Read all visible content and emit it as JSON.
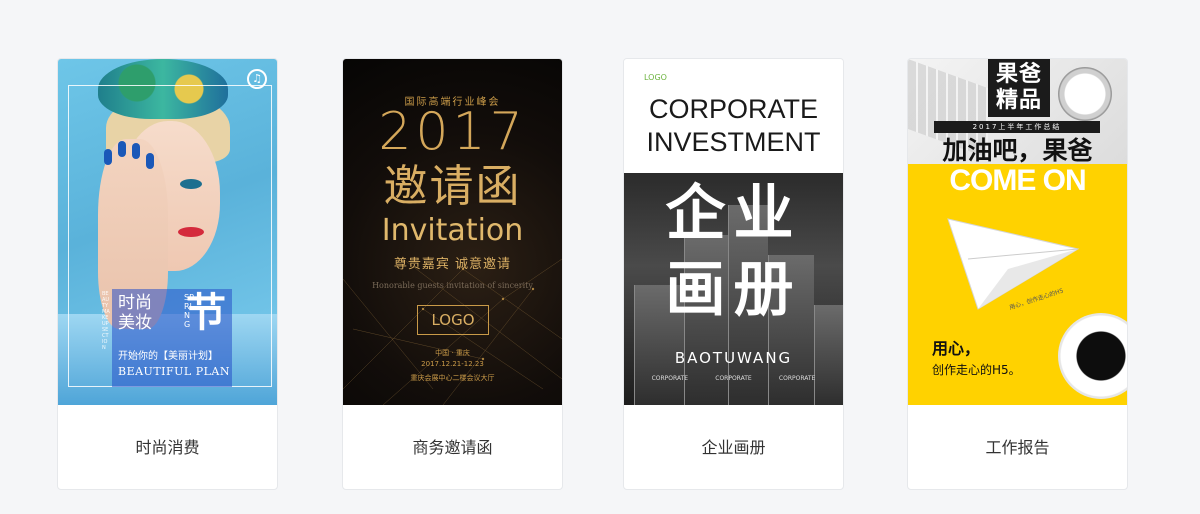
{
  "cards": [
    {
      "caption": "时尚消费",
      "poster": {
        "line1": "时尚",
        "line2": "美妆",
        "big_char": "节",
        "spring": "SPRING",
        "subtitle": "开始你的【美丽计划】",
        "slogan": "BEAUTIFUL PLAN",
        "side_text": "BEAUTY MAKE UP SECTION",
        "music_icon": "music-note-icon"
      }
    },
    {
      "caption": "商务邀请函",
      "poster": {
        "top_line": "国际高端行业峰会",
        "year": "2017",
        "title_cn": "邀请函",
        "title_en": "Invitation",
        "sub_cn": "尊贵嘉宾 诚意邀请",
        "sub_en": "Honorable guests  invitation of sincerity",
        "logo": "LOGO",
        "place": "中国 · 重庆",
        "date": "2017.12.21-12.23",
        "venue": "重庆会展中心二楼会议大厅"
      }
    },
    {
      "caption": "企业画册",
      "poster": {
        "logo": "LOGO",
        "head1": "CORPORATE",
        "head2": "INVESTMENT",
        "cn1": "企业",
        "cn2": "画册",
        "brand": "BAOTUWANG",
        "foot": [
          "CORPORATE",
          "CORPORATE",
          "CORPORATE"
        ]
      }
    },
    {
      "caption": "工作报告",
      "poster": {
        "logo": "果爸\n精品",
        "bar": "2017上半年工作总结",
        "title": "加油吧，果爸",
        "come_on": "COME ON",
        "slogan1": "用心，",
        "slogan2": "创作走心的H5。",
        "curve_text": "用心，创作走心的H5"
      }
    }
  ],
  "colors": {
    "background": "#f5f6f8",
    "card_border": "#e6e8eb",
    "caption_text": "#333333",
    "gold": "#d4a75a",
    "report_yellow": "#ffd200",
    "corporate_green": "#6cb33f"
  }
}
